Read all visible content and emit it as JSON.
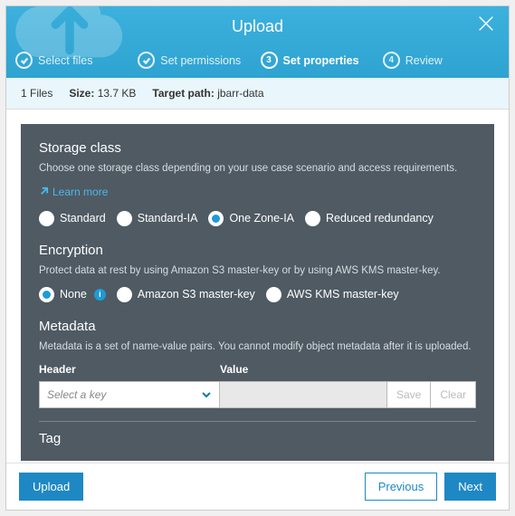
{
  "header": {
    "title": "Upload",
    "steps": [
      {
        "label": "Select files",
        "mark": "check"
      },
      {
        "label": "Set permissions",
        "mark": "check"
      },
      {
        "label": "Set properties",
        "mark": "3"
      },
      {
        "label": "Review",
        "mark": "4"
      }
    ],
    "active_step": 2
  },
  "infobar": {
    "files_label": "1 Files",
    "size_label": "Size:",
    "size_value": "13.7 KB",
    "target_label": "Target path:",
    "target_value": "jbarr-data"
  },
  "storage": {
    "heading": "Storage class",
    "desc": "Choose one storage class depending on your use case scenario and access requirements.",
    "learn_more": "Learn more",
    "options": [
      "Standard",
      "Standard-IA",
      "One Zone-IA",
      "Reduced redundancy"
    ],
    "selected": 2
  },
  "encryption": {
    "heading": "Encryption",
    "desc": "Protect data at rest by using Amazon S3 master-key or by using AWS KMS master-key.",
    "options": [
      "None",
      "Amazon S3 master-key",
      "AWS KMS master-key"
    ],
    "selected": 0
  },
  "metadata": {
    "heading": "Metadata",
    "desc": "Metadata is a set of name-value pairs. You cannot modify object metadata after it is uploaded.",
    "header_col": "Header",
    "value_col": "Value",
    "key_placeholder": "Select a key",
    "save": "Save",
    "clear": "Clear"
  },
  "tag": {
    "heading": "Tag"
  },
  "footer": {
    "upload": "Upload",
    "previous": "Previous",
    "next": "Next"
  }
}
